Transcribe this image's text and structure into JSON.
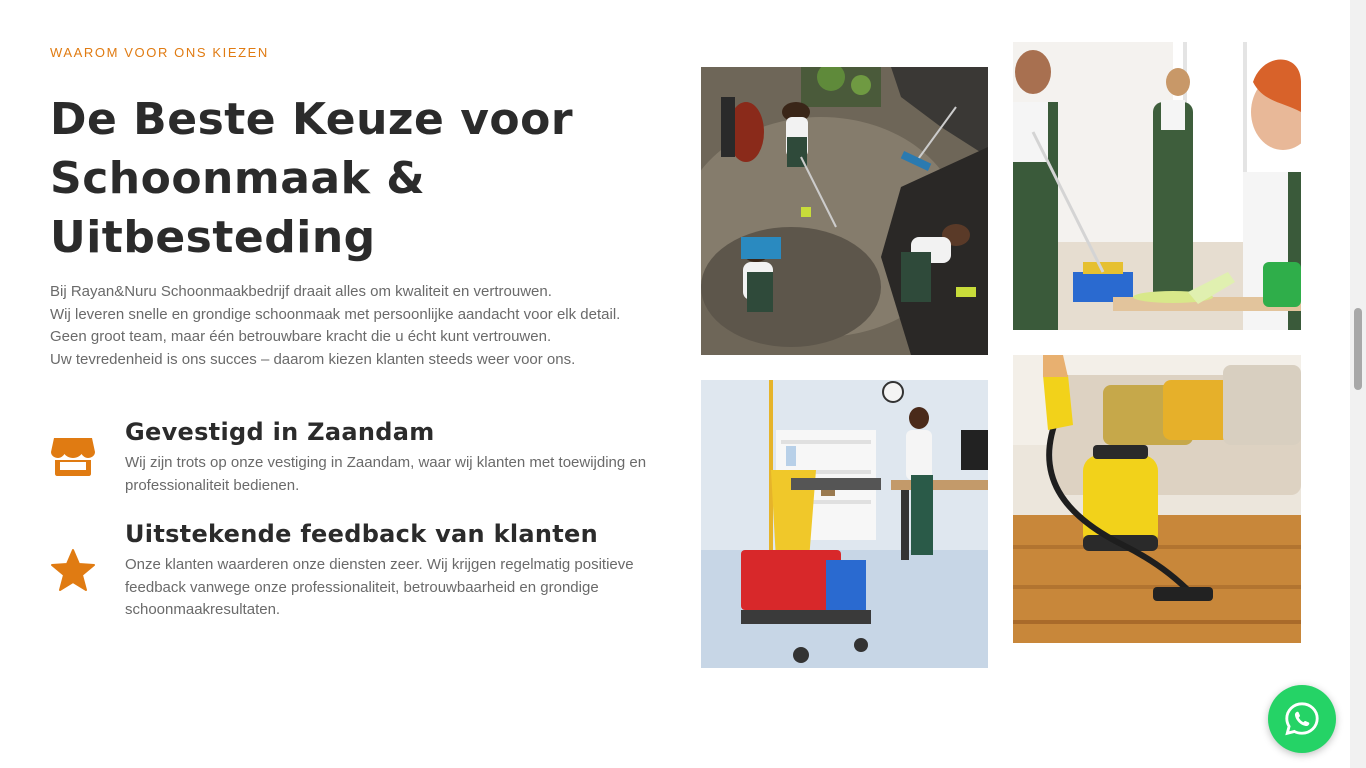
{
  "section": {
    "eyebrow": "WAAROM VOOR ONS KIEZEN",
    "title_lines": [
      "De Beste Keuze voor",
      "Schoonmaak &",
      "Uitbesteding"
    ],
    "intro_lines": [
      "Bij Rayan&Nuru Schoonmaakbedrijf draait alles om kwaliteit en vertrouwen.",
      "Wij leveren snelle en grondige schoonmaak met persoonlijke aandacht voor elk detail.",
      "Geen groot team, maar één betrouwbare kracht die u écht kunt vertrouwen.",
      "Uw tevredenheid is ons succes – daarom kiezen klanten steeds weer voor ons."
    ]
  },
  "features": [
    {
      "icon": "store-icon",
      "title": "Gevestigd in Zaandam",
      "text_lines": [
        "Wij zijn trots op onze vestiging in Zaandam, waar wij klanten met toewijding en",
        "professionaliteit bedienen."
      ]
    },
    {
      "icon": "star-icon",
      "title": "Uitstekende feedback van klanten",
      "text_lines": [
        "Onze klanten waarderen onze diensten zeer. Wij krijgen regelmatig positieve",
        "feedback vanwege onze professionaliteit, betrouwbaarheid en grondige",
        "schoonmaakresultaten."
      ]
    }
  ],
  "colors": {
    "accent": "#e07b12",
    "heading": "#2b2b2b",
    "body_text": "#6a6a6a",
    "whatsapp": "#25d366"
  },
  "whatsapp_button": {
    "icon": "whatsapp-icon"
  }
}
